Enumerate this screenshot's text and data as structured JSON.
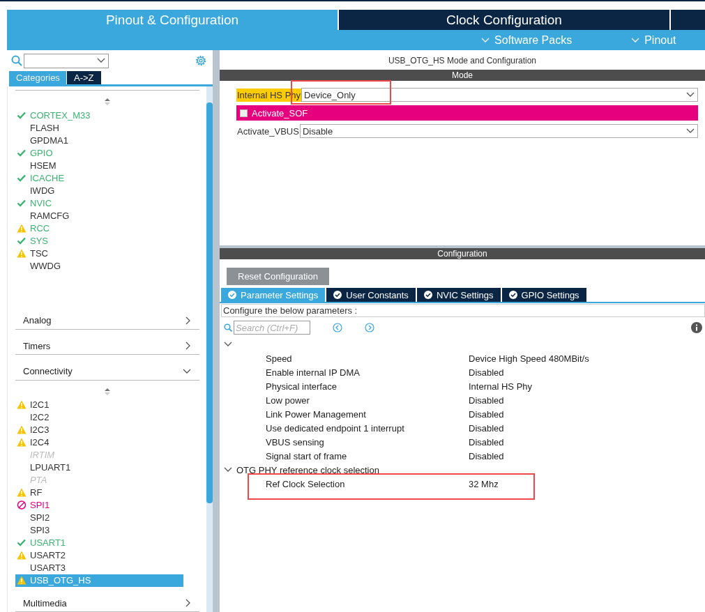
{
  "top_tabs": [
    {
      "label": "Pinout & Configuration",
      "selected": true
    },
    {
      "label": "Clock Configuration",
      "selected": false
    },
    {
      "selected": false
    }
  ],
  "sub_menu": [
    "Software Packs",
    "Pinout"
  ],
  "sidebar": {
    "tabs": [
      {
        "label": "Categories",
        "selected": true
      },
      {
        "label": "A->Z",
        "selected": false
      }
    ],
    "top_items": [
      {
        "label": "CORTEX_M33",
        "kind": "ok"
      },
      {
        "label": "FLASH",
        "kind": "none"
      },
      {
        "label": "GPDMA1",
        "kind": "none"
      },
      {
        "label": "GPIO",
        "kind": "ok"
      },
      {
        "label": "HSEM",
        "kind": "none"
      },
      {
        "label": "ICACHE",
        "kind": "ok"
      },
      {
        "label": "IWDG",
        "kind": "none"
      },
      {
        "label": "NVIC",
        "kind": "ok"
      },
      {
        "label": "RAMCFG",
        "kind": "none"
      },
      {
        "label": "RCC",
        "kind": "partial"
      },
      {
        "label": "SYS",
        "kind": "ok"
      },
      {
        "label": "TSC",
        "kind": "warning"
      },
      {
        "label": "WWDG",
        "kind": "none"
      }
    ],
    "sections": [
      {
        "label": "Analog",
        "expanded": false
      },
      {
        "label": "Timers",
        "expanded": false
      },
      {
        "label": "Connectivity",
        "expanded": true,
        "items": [
          {
            "label": "I2C1",
            "kind": "warning",
            "selected": false
          },
          {
            "label": "I2C2",
            "kind": "none",
            "selected": false
          },
          {
            "label": "I2C3",
            "kind": "warning",
            "selected": false
          },
          {
            "label": "I2C4",
            "kind": "warning",
            "selected": false
          },
          {
            "label": "IRTIM",
            "kind": "disabled",
            "selected": false
          },
          {
            "label": "LPUART1",
            "kind": "none",
            "selected": false
          },
          {
            "label": "PTA",
            "kind": "disabled",
            "selected": false
          },
          {
            "label": "RF",
            "kind": "warning",
            "selected": false
          },
          {
            "label": "SPI1",
            "kind": "error",
            "selected": false
          },
          {
            "label": "SPI2",
            "kind": "none",
            "selected": false
          },
          {
            "label": "SPI3",
            "kind": "none",
            "selected": false
          },
          {
            "label": "USART1",
            "kind": "ok",
            "selected": false
          },
          {
            "label": "USART2",
            "kind": "warning",
            "selected": false
          },
          {
            "label": "USART3",
            "kind": "none",
            "selected": false
          },
          {
            "label": "USB_OTG_HS",
            "kind": "warning",
            "selected": true
          }
        ]
      },
      {
        "label": "Multimedia",
        "expanded": false
      }
    ]
  },
  "panel": {
    "title": "USB_OTG_HS Mode and Configuration",
    "mode_header": "Mode",
    "mode_rows": [
      {
        "kind": "select",
        "label": "Internal HS Phy",
        "value": "Device_Only",
        "label_highlight": true,
        "highlighted": true
      },
      {
        "kind": "checkbox",
        "label": "Activate_SOF",
        "checked": false
      },
      {
        "kind": "select",
        "label": "Activate_VBUS",
        "value": "Disable",
        "label_highlight": false,
        "highlighted": false
      }
    ],
    "config_header": "Configuration",
    "reset_button": "Reset Configuration",
    "tabs": [
      {
        "label": "Parameter Settings",
        "selected": true
      },
      {
        "label": "User Constants",
        "selected": false
      },
      {
        "label": "NVIC Settings",
        "selected": false
      },
      {
        "label": "GPIO Settings",
        "selected": false
      }
    ],
    "hint": "Configure the below parameters :",
    "search_placeholder": "Search (Ctrl+F)",
    "groups": [
      {
        "expanded": true,
        "rows": [
          {
            "name": "Speed",
            "value": "Device High Speed 480MBit/s",
            "highlighted": false
          },
          {
            "name": "Enable internal IP DMA",
            "value": "Disabled",
            "highlighted": false
          },
          {
            "name": "Physical interface",
            "value": "Internal HS Phy",
            "highlighted": false
          },
          {
            "name": "Low power",
            "value": "Disabled",
            "highlighted": false
          },
          {
            "name": "Link Power Management",
            "value": "Disabled",
            "highlighted": false
          },
          {
            "name": "Use dedicated endpoint 1 interrupt",
            "value": "Disabled",
            "highlighted": false
          },
          {
            "name": "VBUS sensing",
            "value": "Disabled",
            "highlighted": false
          },
          {
            "name": "Signal start of frame",
            "value": "Disabled",
            "highlighted": false
          }
        ]
      },
      {
        "label": "OTG PHY reference clock selection",
        "expanded": true,
        "rows": [
          {
            "name": "Ref Clock Selection",
            "value": "32 Mhz",
            "highlighted": true
          }
        ]
      }
    ]
  }
}
